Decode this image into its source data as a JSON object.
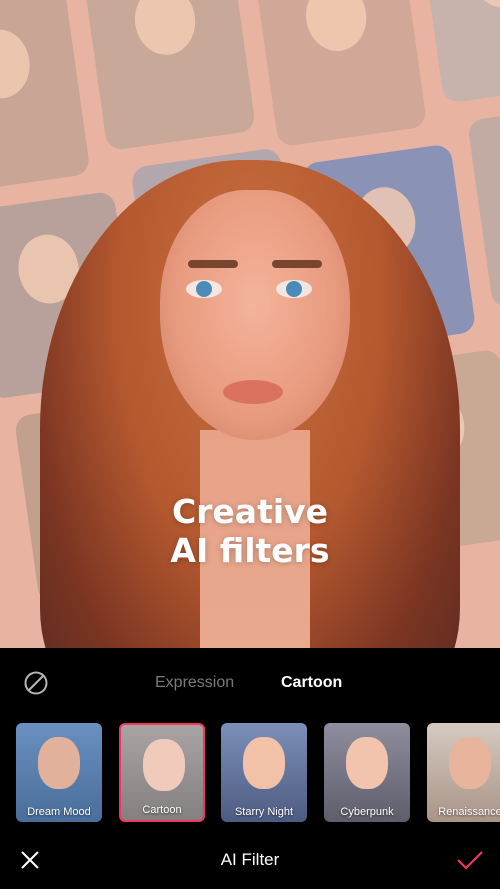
{
  "hero": {
    "headline_line1": "Creative",
    "headline_line2": "AI filters"
  },
  "tabs": [
    {
      "label": "Expression",
      "active": false
    },
    {
      "label": "Cartoon",
      "active": true
    }
  ],
  "no_filter_icon": "no-filter-icon",
  "filters": [
    {
      "label": "Dream Mood",
      "selected": false,
      "bg": "#5f86b5",
      "skin": "#e2b19c"
    },
    {
      "label": "Cartoon",
      "selected": true,
      "bg": "#9a9494",
      "skin": "#f0cbbb"
    },
    {
      "label": "Starry Night",
      "selected": false,
      "bg": "#6d7fa6",
      "skin": "#f1c1a8"
    },
    {
      "label": "Cyberpunk",
      "selected": false,
      "bg": "#7f7e8c",
      "skin": "#f2c3ad"
    },
    {
      "label": "Renaissance",
      "selected": false,
      "bg": "#cdbfb4",
      "skin": "#e8b59c"
    }
  ],
  "bottom_bar": {
    "title": "AI Filter",
    "close_icon": "close-icon",
    "confirm_icon": "check-icon"
  },
  "colors": {
    "accent": "#f0355f",
    "panel_bg": "#000000",
    "inactive_tab": "#7a7a7a",
    "collage_bg": "#e9b3a2"
  }
}
